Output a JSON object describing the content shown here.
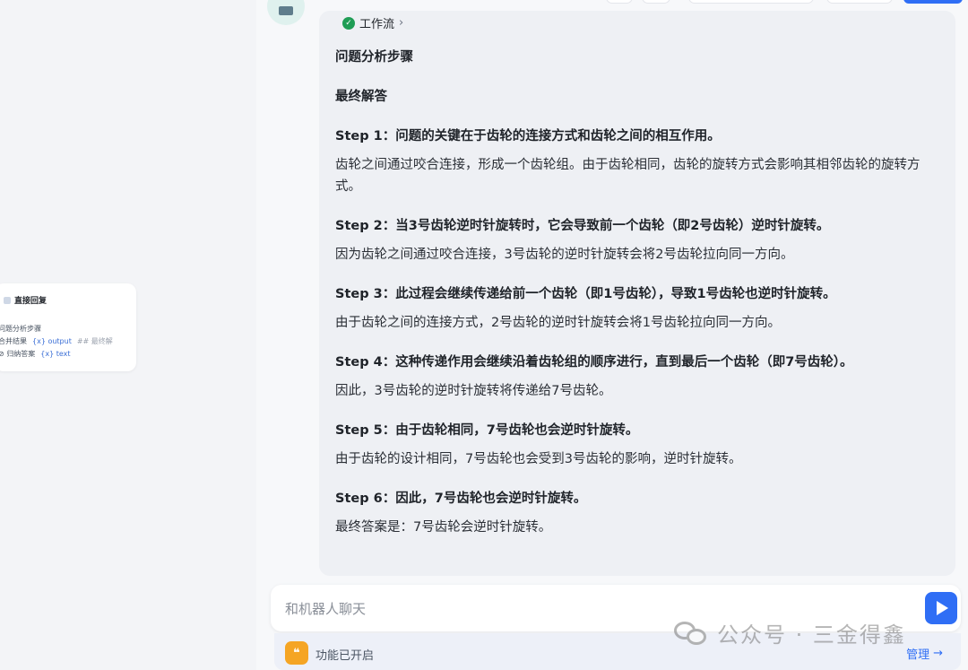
{
  "node_card": {
    "title": "直接回复",
    "rows": [
      {
        "text": "问题分析步骤"
      },
      {
        "text": "合并结果",
        "var": "{x} output",
        "extra": "## 最终解"
      },
      {
        "text": "⊘ 归纳答案",
        "var": "{x} text"
      }
    ]
  },
  "answer": {
    "workflow_label": "工作流",
    "heading1": "问题分析步骤",
    "heading2": "最终解答",
    "steps": [
      {
        "title": "Step 1：问题的关键在于齿轮的连接方式和齿轮之间的相互作用。",
        "body": "齿轮之间通过咬合连接，形成一个齿轮组。由于齿轮相同，齿轮的旋转方式会影响其相邻齿轮的旋转方式。"
      },
      {
        "title": "Step 2：当3号齿轮逆时针旋转时，它会导致前一个齿轮（即2号齿轮）逆时针旋转。",
        "body": "因为齿轮之间通过咬合连接，3号齿轮的逆时针旋转会将2号齿轮拉向同一方向。"
      },
      {
        "title": "Step 3：此过程会继续传递给前一个齿轮（即1号齿轮），导致1号齿轮也逆时针旋转。",
        "body": "由于齿轮之间的连接方式，2号齿轮的逆时针旋转会将1号齿轮拉向同一方向。"
      },
      {
        "title": "Step 4：这种传递作用会继续沿着齿轮组的顺序进行，直到最后一个齿轮（即7号齿轮）。",
        "body": "因此，3号齿轮的逆时针旋转将传递给7号齿轮。"
      },
      {
        "title": "Step 5：由于齿轮相同，7号齿轮也会逆时针旋转。",
        "body": "由于齿轮的设计相同，7号齿轮也会受到3号齿轮的影响，逆时针旋转。"
      },
      {
        "title": "Step 6：因此，7号齿轮也会逆时针旋转。",
        "body": "最终答案是：7号齿轮会逆时针旋转。"
      }
    ]
  },
  "input": {
    "placeholder": "和机器人聊天"
  },
  "feature_bar": {
    "label": "功能已开启",
    "manage": "管理"
  },
  "watermark": {
    "text": "公众号 · 三金得鑫"
  },
  "colors": {
    "accent": "#2f6ef5",
    "success": "#1f9d55",
    "feature_icon": "#f5a524"
  }
}
